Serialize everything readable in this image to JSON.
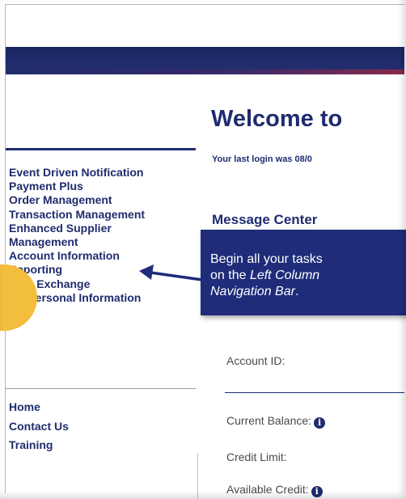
{
  "nav": {
    "items": [
      "Event Driven Notification",
      "Payment Plus",
      "Order Management",
      "Transaction Management",
      "Enhanced Supplier",
      "Management",
      "Account Information",
      "Reporting",
      "Data Exchange",
      "My Personal Information"
    ],
    "secondary": [
      "Home",
      "Contact Us",
      "Training"
    ]
  },
  "main": {
    "welcome": "Welcome to",
    "last_login": "Your last login was 08/0",
    "message_center": "Message Center",
    "account_id_label": "Account ID:",
    "current_balance_label": "Current Balance:",
    "credit_limit_label": "Credit Limit:",
    "available_credit_label": "Available Credit:"
  },
  "callout": {
    "line1": "Begin all your tasks",
    "line2_prefix": "on the ",
    "line2_italic": "Left Column",
    "line3_italic": "Navigation Bar",
    "line3_suffix": "."
  },
  "icons": {
    "info": "info-icon",
    "arrow": "arrow-icon"
  },
  "colors": {
    "brand_navy": "#1f2c6e",
    "callout_bg": "#1f2c7a",
    "highlight_yellow": "#f3bd3d"
  }
}
